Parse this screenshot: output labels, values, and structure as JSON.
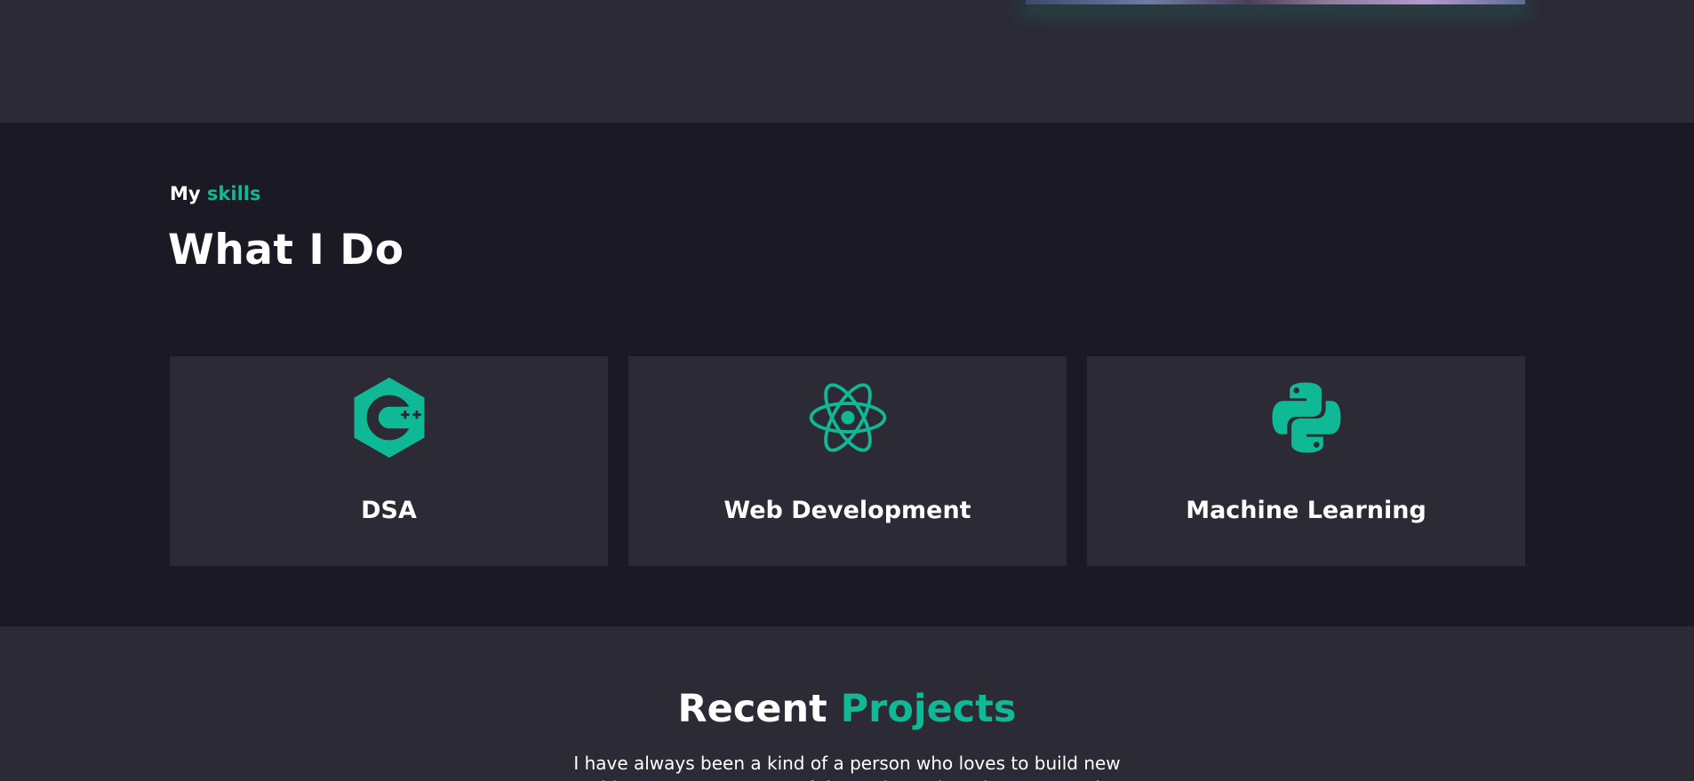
{
  "colors": {
    "accent": "#10b995",
    "page_bg": "#2b2a35",
    "section_bg": "#1b1a24",
    "card_bg": "#2b2a35",
    "text": "#ffffff"
  },
  "skills": {
    "eyebrow_prefix": "My",
    "eyebrow_accent": "skills",
    "title": "What I Do",
    "cards": [
      {
        "label": "DSA",
        "icon": "cpp-icon"
      },
      {
        "label": "Web Development",
        "icon": "react-icon"
      },
      {
        "label": "Machine Learning",
        "icon": "python-icon"
      }
    ]
  },
  "projects": {
    "title_prefix": "Recent",
    "title_accent": "Projects",
    "description": "I have always been a kind of a person who loves to build new things. Here are some of the projects that I have created"
  }
}
